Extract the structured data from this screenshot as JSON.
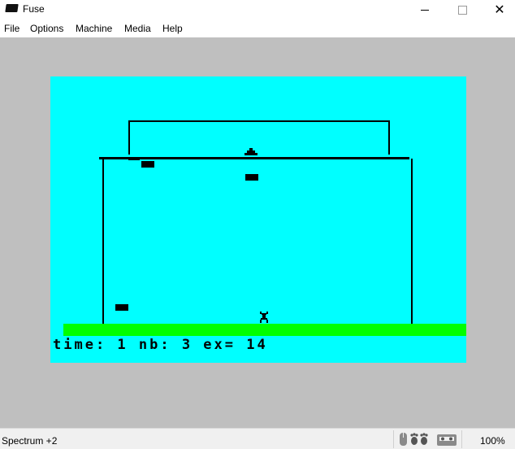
{
  "window": {
    "title": "Fuse",
    "app_icon": "spectrum-icon"
  },
  "menu": [
    "File",
    "Options",
    "Machine",
    "Media",
    "Help"
  ],
  "game": {
    "hud_text": "time: 1 nb: 3 ex= 14",
    "colors": {
      "background": "#00ffff",
      "floor": "#00ff00",
      "border": "#bfbfbf",
      "ink": "#000000"
    }
  },
  "status": {
    "machine": "Spectrum +2",
    "speed": "100%",
    "icons": [
      "mouse-icon",
      "footprints-icon",
      "tape-icon"
    ]
  }
}
